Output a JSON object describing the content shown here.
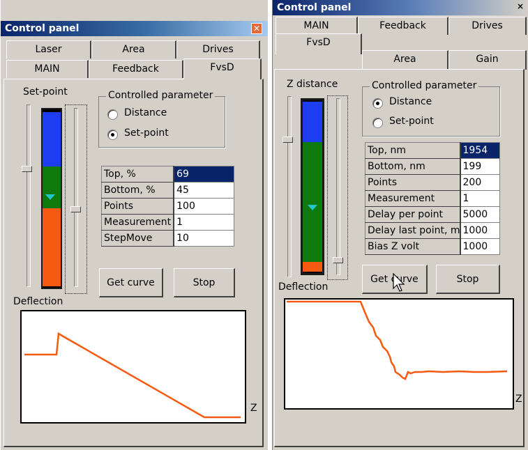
{
  "colors": {
    "blue": "#1e3cf0",
    "green": "#0e7a0e",
    "orange": "#f55a10",
    "curve": "#f55a10",
    "cyan": "#20c8c8"
  },
  "left": {
    "title": "Control panel",
    "tabs_back": [
      "Laser",
      "Area",
      "Drives"
    ],
    "tabs_front": [
      "MAIN",
      "Feedback",
      "FvsD"
    ],
    "active_tab": "FvsD",
    "slider_label": "Set-point",
    "group_label": "Controlled parameter",
    "radio_distance": "Distance",
    "radio_setpoint": "Set-point",
    "selected_radio": "Set-point",
    "grid": [
      {
        "name": "Top, %",
        "value": "69"
      },
      {
        "name": "Bottom, %",
        "value": "45"
      },
      {
        "name": "Points",
        "value": "100"
      },
      {
        "name": "Measurement",
        "value": "1"
      },
      {
        "name": "StepMove",
        "value": "10"
      }
    ],
    "get_curve": "Get curve",
    "stop": "Stop",
    "deflection": "Deflection",
    "z": "Z"
  },
  "right": {
    "title": "Control panel",
    "close": "×",
    "tabs_back": [
      "MAIN",
      "Feedback",
      "Drives"
    ],
    "tabs_front": [
      "FvsD",
      "Area",
      "Gain"
    ],
    "active_tab": "FvsD",
    "slider_label": "Z distance",
    "group_label": "Controlled parameter",
    "radio_distance": "Distance",
    "radio_setpoint": "Set-point",
    "selected_radio": "Distance",
    "grid": [
      {
        "name": "Top, nm",
        "value": "1954"
      },
      {
        "name": "Bottom, nm",
        "value": "199"
      },
      {
        "name": "Points",
        "value": "200"
      },
      {
        "name": "Measurement",
        "value": "1"
      },
      {
        "name": "Delay per point",
        "value": "5000"
      },
      {
        "name": "Delay last point, m",
        "value": "1000"
      },
      {
        "name": "Bias Z volt",
        "value": "1000"
      }
    ],
    "get_curve": "Get curve",
    "stop": "Stop",
    "deflection": "Deflection",
    "z": "Z"
  }
}
